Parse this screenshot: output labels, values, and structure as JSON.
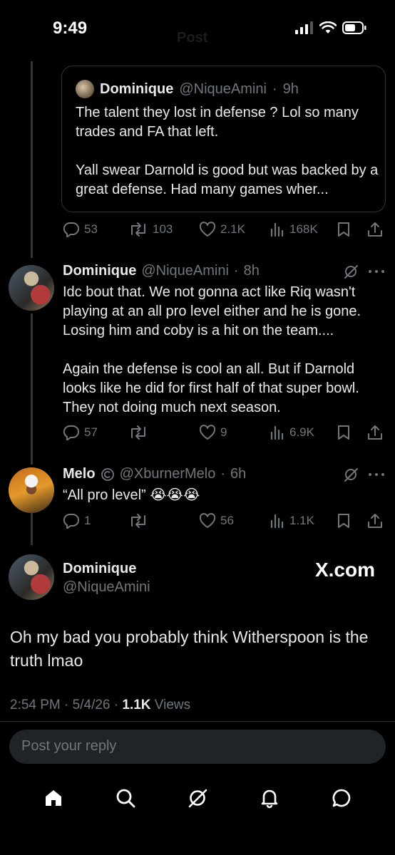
{
  "status": {
    "time": "9:49"
  },
  "header": {
    "title": "Post"
  },
  "quoted": {
    "name": "Dominique",
    "handle": "@NiqueAmini",
    "time": "9h",
    "text": "The talent they lost in defense ? Lol so many trades and FA that left.\n\nYall swear Darnold is good but was backed by a great defense. Had many games wher...",
    "replies": "53",
    "reposts": "103",
    "likes": "2.1K",
    "views": "168K"
  },
  "reply1": {
    "name": "Dominique",
    "handle": "@NiqueAmini",
    "time": "8h",
    "text": "Idc bout that. We not gonna act like Riq wasn't playing at an all pro level either and he is gone. Losing him and coby is a hit on the team....\n\nAgain the defense is cool an all. But if Darnold looks like he did for first half of that super bowl. They not doing much next season.",
    "replies": "57",
    "likes": "9",
    "views": "6.9K"
  },
  "reply2": {
    "name": "Melo",
    "handle": "@XburnerMelo",
    "time": "6h",
    "text": "“All pro level” 😭😭😭",
    "replies": "1",
    "likes": "56",
    "views": "1.1K"
  },
  "main": {
    "name": "Dominique",
    "handle": "@NiqueAmini",
    "brand": "X.com",
    "text": "Oh my bad you probably think Witherspoon is the truth lmao",
    "time": "2:54 PM",
    "date": "5/4/26",
    "views_count": "1.1K",
    "views_label": "Views"
  },
  "compose": {
    "placeholder": "Post your reply"
  },
  "colors": {
    "background": "#000000",
    "muted": "#71767b",
    "text": "#e7e9ea",
    "border": "#2f3336"
  }
}
